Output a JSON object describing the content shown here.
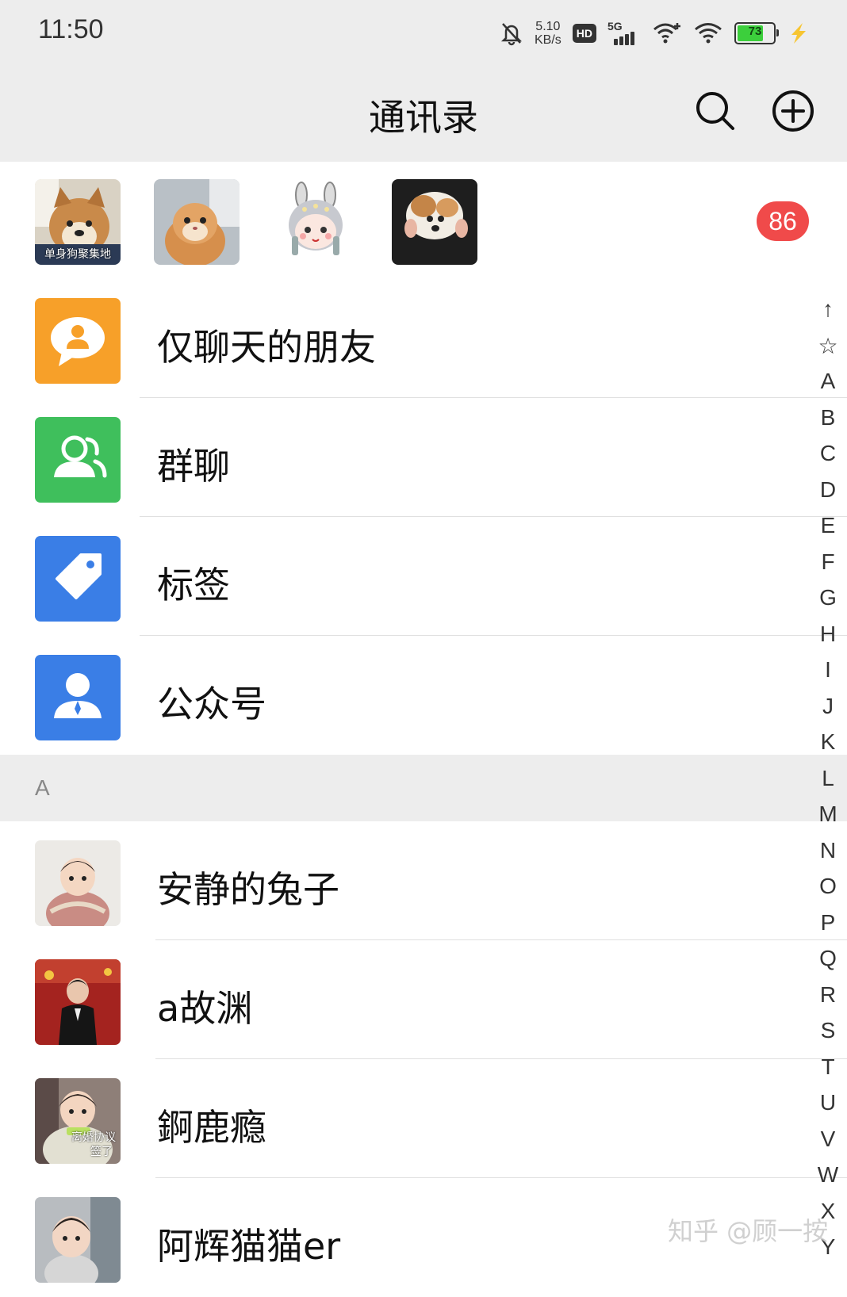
{
  "status_bar": {
    "time": "11:50",
    "net_speed_value": "5.10",
    "net_speed_unit": "KB/s",
    "hd_label": "HD",
    "network_label": "5G",
    "battery_level": "73"
  },
  "header": {
    "title": "通讯录",
    "search_icon": "search-icon",
    "add_icon": "plus-circle-icon"
  },
  "recent_contacts": {
    "first_avatar_caption": "单身狗聚集地",
    "badge_count": "86"
  },
  "menu_entries": [
    {
      "label": "仅聊天的朋友",
      "icon": "chat-only-friends-icon",
      "color": "#f7a029"
    },
    {
      "label": "群聊",
      "icon": "group-chat-icon",
      "color": "#3fbf5c"
    },
    {
      "label": "标签",
      "icon": "tag-icon",
      "color": "#3a7ee6"
    },
    {
      "label": "公众号",
      "icon": "official-account-icon",
      "color": "#3a7ee6"
    }
  ],
  "section": {
    "letter": "A"
  },
  "contacts": [
    {
      "name": "安静的兔子"
    },
    {
      "name": "a故渊"
    },
    {
      "name": "錒鹿瘾",
      "avatar_caption_1": "离婚协议",
      "avatar_caption_2": "签了"
    },
    {
      "name": "阿辉猫猫er"
    }
  ],
  "alpha_index": [
    "↑",
    "☆",
    "A",
    "B",
    "C",
    "D",
    "E",
    "F",
    "G",
    "H",
    "I",
    "J",
    "K",
    "L",
    "M",
    "N",
    "O",
    "P",
    "Q",
    "R",
    "S",
    "T",
    "U",
    "V",
    "W",
    "X",
    "Y"
  ],
  "watermark": "知乎 @顾一按"
}
